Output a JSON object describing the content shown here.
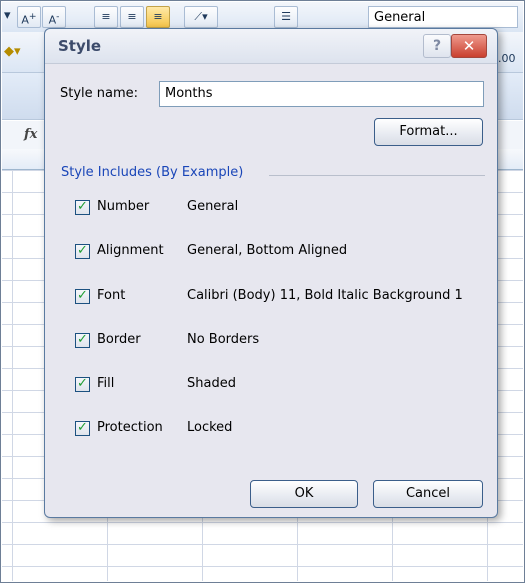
{
  "background": {
    "number_format": "General",
    "decimal_icon": ".00",
    "fx_label": "fx"
  },
  "dialog": {
    "title": "Style",
    "help_glyph": "?",
    "close_glyph": "✕",
    "style_name_label": "Style name:",
    "style_name_value": "Months",
    "format_button": "Format...",
    "group_label": "Style Includes (By Example)",
    "items": [
      {
        "label": "Number",
        "value": "General",
        "checked": true
      },
      {
        "label": "Alignment",
        "value": "General, Bottom Aligned",
        "checked": true
      },
      {
        "label": "Font",
        "value": "Calibri (Body) 11, Bold Italic Background 1",
        "checked": true
      },
      {
        "label": "Border",
        "value": "No Borders",
        "checked": true
      },
      {
        "label": "Fill",
        "value": "Shaded",
        "checked": true
      },
      {
        "label": "Protection",
        "value": "Locked",
        "checked": true
      }
    ],
    "ok_button": "OK",
    "cancel_button": "Cancel"
  },
  "colors": {
    "accent": "#1a46b8",
    "check": "#1e9d32",
    "close": "#c9402f"
  }
}
